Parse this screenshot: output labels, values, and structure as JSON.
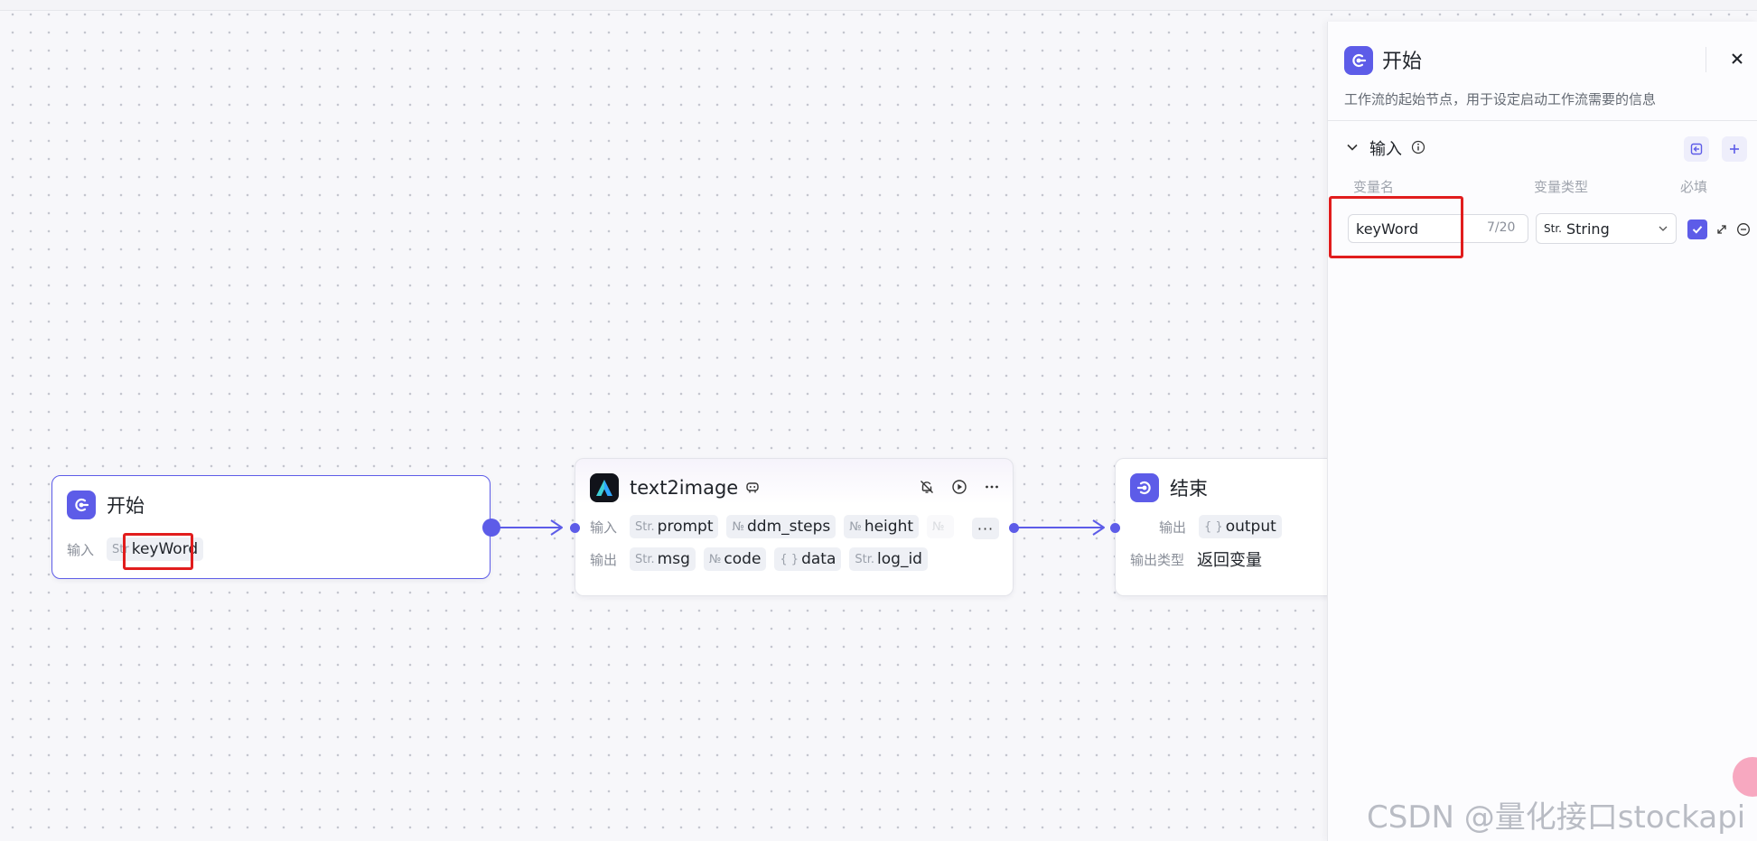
{
  "start_node": {
    "title": "开始",
    "input_label": "输入",
    "input_var": {
      "type": "Str",
      "name": "keyWord"
    }
  },
  "llm_node": {
    "title": "text2image",
    "input_label": "输入",
    "output_label": "输出",
    "inputs": [
      {
        "type": "Str.",
        "name": "prompt"
      },
      {
        "type": "№",
        "name": "ddm_steps"
      },
      {
        "type": "№",
        "name": "height"
      },
      {
        "type": "№",
        "name": "..."
      }
    ],
    "outputs": [
      {
        "type": "Str.",
        "name": "msg"
      },
      {
        "type": "№",
        "name": "code"
      },
      {
        "type": "{ }",
        "name": "data"
      },
      {
        "type": "Str.",
        "name": "log_id"
      }
    ],
    "more_label": "···"
  },
  "end_node": {
    "title": "结束",
    "output_label": "输出",
    "output_var": {
      "type": "{ }",
      "name": "output"
    },
    "output_type_label": "输出类型",
    "output_type_value": "返回变量"
  },
  "panel": {
    "title": "开始",
    "description": "工作流的起始节点，用于设定启动工作流需要的信息",
    "section_title": "输入",
    "columns": {
      "name": "变量名",
      "type": "变量类型",
      "required": "必填"
    },
    "variable": {
      "name": "keyWord",
      "counter": "7/20",
      "type_prefix": "Str.",
      "type_value": "String"
    }
  },
  "watermark": "CSDN @量化接口stockapi",
  "colors": {
    "accent": "#5d5ce8",
    "highlight": "#e11d1d"
  }
}
